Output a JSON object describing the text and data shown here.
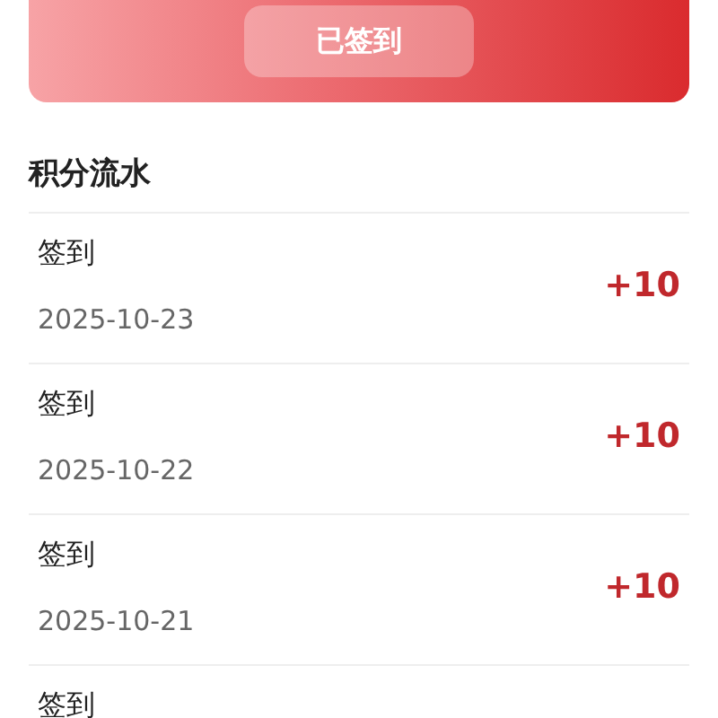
{
  "checkin_card": {
    "button": "已签到"
  },
  "section_title": "积分流水",
  "records": [
    {
      "title": "签到",
      "date": "2025-10-23",
      "points": "+10"
    },
    {
      "title": "签到",
      "date": "2025-10-22",
      "points": "+10"
    },
    {
      "title": "签到",
      "date": "2025-10-21",
      "points": "+10"
    },
    {
      "title": "签到"
    }
  ]
}
